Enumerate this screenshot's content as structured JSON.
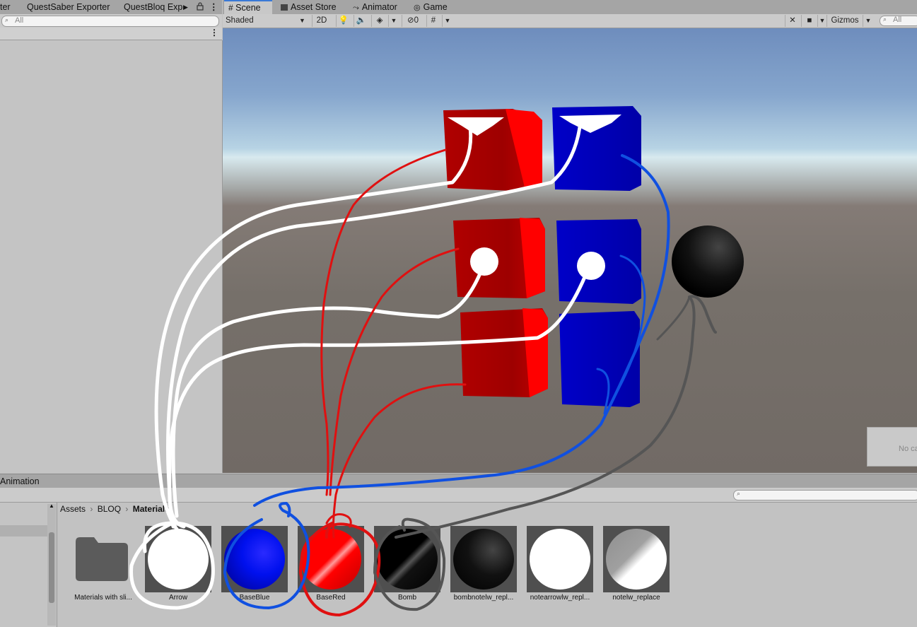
{
  "left_tabs": [
    "ter",
    "QuestSaber Exporter",
    "QuestBloq Exp"
  ],
  "left_search": {
    "placeholder": "All"
  },
  "scene_tabs": [
    "Scene",
    "Asset Store",
    "Animator",
    "Game"
  ],
  "scene_toolbar": {
    "shading_mode": "Shaded",
    "mode_2d": "2D",
    "hidden_count": "0",
    "gizmos_label": "Gizmos",
    "search_placeholder": "All"
  },
  "overlay": {
    "no_camera_text": "No ca"
  },
  "bottom": {
    "tab_label": "Animation",
    "breadcrumb": [
      "Assets",
      "BLOQ",
      "Materials"
    ],
    "assets": [
      {
        "label": "Materials with sli...",
        "kind": "folder",
        "color": ""
      },
      {
        "label": "Arrow",
        "kind": "material",
        "color": "#ffffff"
      },
      {
        "label": "BaseBlue",
        "kind": "material",
        "color": "#0010ee"
      },
      {
        "label": "BaseRed",
        "kind": "material",
        "color": "#ff0000"
      },
      {
        "label": "Bomb",
        "kind": "material",
        "color": "#000000"
      },
      {
        "label": "bombnotelw_repl...",
        "kind": "material",
        "color": "#000000"
      },
      {
        "label": "notearrowlw_repl...",
        "kind": "material",
        "color": "#ffffff"
      },
      {
        "label": "notelw_replace",
        "kind": "material",
        "color": "#c8c8c8"
      }
    ]
  },
  "colors": {
    "red_block": "#ff0000",
    "blue_block": "#0000e0",
    "annotation_white": "#ffffff",
    "annotation_red": "#e01010",
    "annotation_blue": "#1050e0",
    "annotation_gray": "#555555",
    "tab_accent": "#3a79d6"
  }
}
